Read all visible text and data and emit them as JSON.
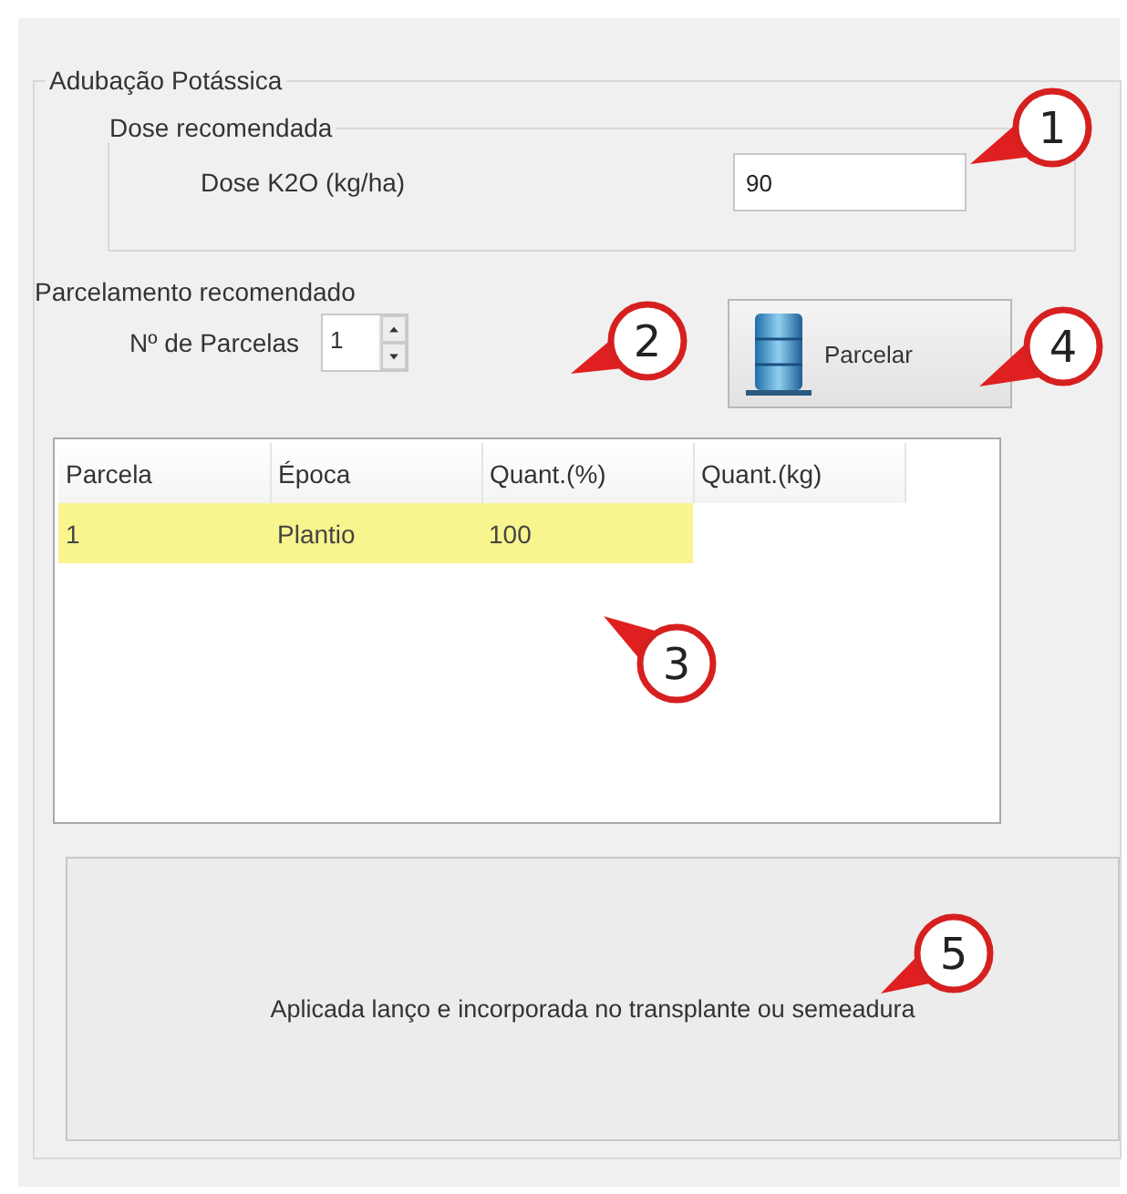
{
  "group": {
    "title": "Adubação Potássica"
  },
  "dose": {
    "title": "Dose recomendada",
    "label": "Dose K2O (kg/ha)",
    "value": "90"
  },
  "parcelamento": {
    "title": "Parcelamento recomendado",
    "label": "Nº de Parcelas",
    "value": "1"
  },
  "button": {
    "label": "Parcelar"
  },
  "table": {
    "columns": [
      "Parcela",
      "Época",
      "Quant.(%)",
      "Quant.(kg)"
    ],
    "rows": [
      {
        "cells": [
          "1",
          "Plantio",
          "100",
          ""
        ],
        "selected": true
      }
    ]
  },
  "note": "Aplicada lanço e incorporada no transplante ou semeadura",
  "callouts": [
    {
      "label": "1"
    },
    {
      "label": "2"
    },
    {
      "label": "3"
    },
    {
      "label": "4"
    },
    {
      "label": "5"
    }
  ]
}
